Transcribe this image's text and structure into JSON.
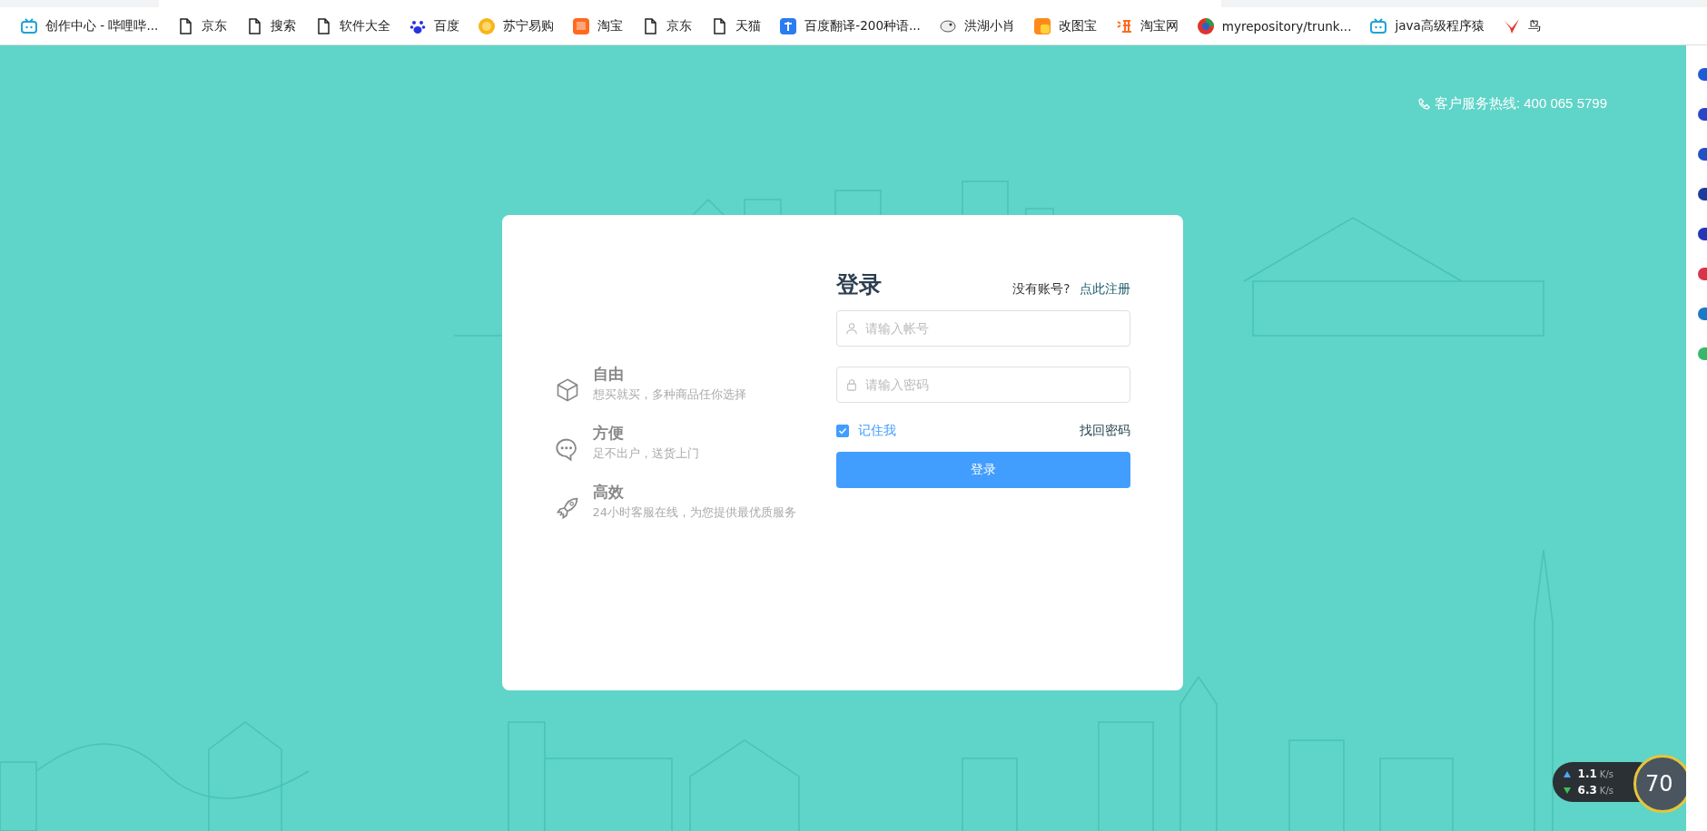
{
  "bookmarks": [
    {
      "label": "创作中心 - 哔哩哔...",
      "kind": "tv"
    },
    {
      "label": "京东",
      "kind": "page"
    },
    {
      "label": "搜索",
      "kind": "page"
    },
    {
      "label": "软件大全",
      "kind": "page"
    },
    {
      "label": "百度",
      "kind": "paw"
    },
    {
      "label": "苏宁易购",
      "kind": "sun"
    },
    {
      "label": "淘宝",
      "kind": "tile"
    },
    {
      "label": "京东",
      "kind": "page"
    },
    {
      "label": "天猫",
      "kind": "page"
    },
    {
      "label": "百度翻译-200种语...",
      "kind": "square"
    },
    {
      "label": "洪湖小肖",
      "kind": "sketch"
    },
    {
      "label": "改图宝",
      "kind": "orange"
    },
    {
      "label": "淘宝网",
      "kind": "glyph"
    },
    {
      "label": "myrepository/trunk...",
      "kind": "globe"
    },
    {
      "label": "java高级程序猿",
      "kind": "tv"
    },
    {
      "label": "鸟",
      "kind": "bird"
    }
  ],
  "hotline": "客户服务热线: 400 065 5799",
  "features": [
    {
      "kind": "box",
      "title": "自由",
      "desc": "想买就买，多种商品任你选择"
    },
    {
      "kind": "chat",
      "title": "方便",
      "desc": "足不出户，送货上门"
    },
    {
      "kind": "rocket",
      "title": "高效",
      "desc": "24小时客服在线，为您提供最优质服务"
    }
  ],
  "login": {
    "title": "登录",
    "no_account": "没有账号?",
    "register_link": "点此注册",
    "account": {
      "placeholder": "请输入帐号"
    },
    "password": {
      "placeholder": "请输入密码"
    },
    "remember": {
      "label": "记住我",
      "checked": true
    },
    "forgot": "找回密码",
    "submit": "登录"
  },
  "speed_widget": {
    "upload": "1.1",
    "upload_unit": "K/s",
    "download": "6.3",
    "download_unit": "K/s",
    "percent": "70"
  }
}
